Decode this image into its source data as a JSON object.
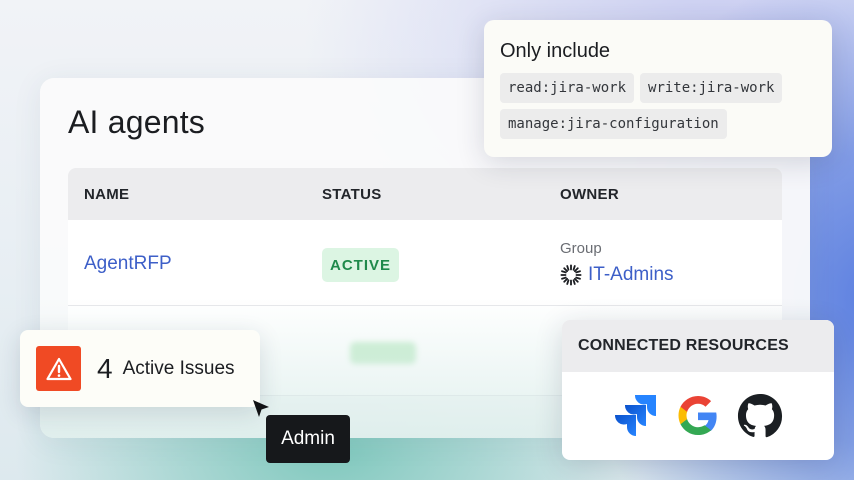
{
  "page": {
    "title": "AI agents"
  },
  "table": {
    "headers": {
      "name": "NAME",
      "status": "STATUS",
      "owner": "OWNER"
    },
    "rows": [
      {
        "name": "AgentRFP",
        "status": "ACTIVE",
        "owner_type": "Group",
        "owner_name": "IT-Admins"
      }
    ]
  },
  "scopes": {
    "title": "Only include",
    "items": [
      "read:jira-work",
      "write:jira-work",
      "manage:jira-configuration"
    ]
  },
  "issues": {
    "count": "4",
    "label": "Active Issues",
    "icon": "warning-icon"
  },
  "cursor": {
    "label": "Admin"
  },
  "resources": {
    "title": "CONNECTED RESOURCES",
    "items": [
      {
        "name": "jira",
        "icon": "jira-icon"
      },
      {
        "name": "google",
        "icon": "google-icon"
      },
      {
        "name": "github",
        "icon": "github-icon"
      }
    ]
  },
  "colors": {
    "link": "#3d5fc8",
    "active_bg": "#dcf5e3",
    "active_text": "#1f8a4b",
    "warning": "#f04a24"
  }
}
